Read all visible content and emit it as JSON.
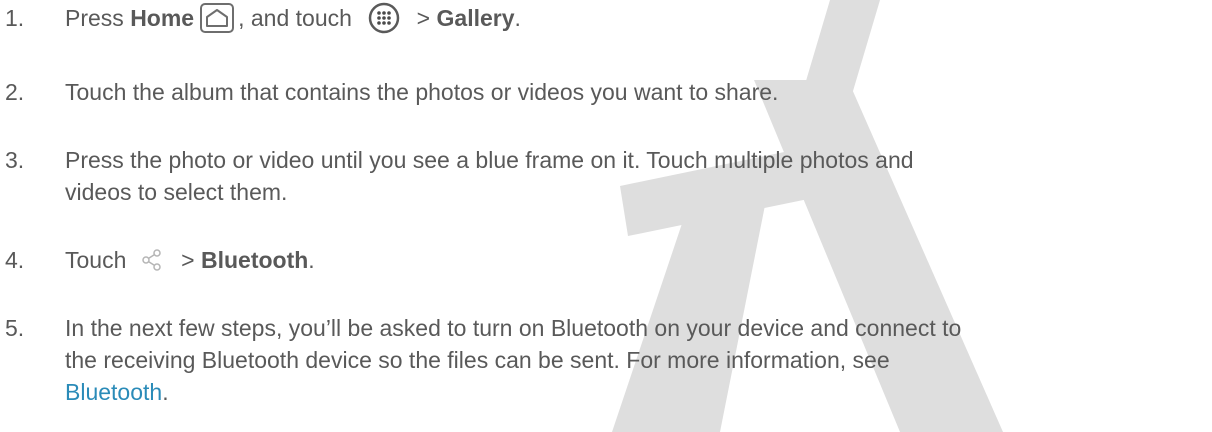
{
  "steps": [
    {
      "number": "1.",
      "press": "Press ",
      "home_label": "Home",
      "home_icon": "home-icon",
      "and_touch": ", and touch ",
      "apps_icon": "apps-icon",
      "separator": " > ",
      "gallery_label": "Gallery",
      "end": "."
    },
    {
      "number": "2.",
      "text": "Touch the album that contains the photos or videos you want to share."
    },
    {
      "number": "3.",
      "line1": "Press the photo or video until you see a blue frame on it. Touch multiple photos and",
      "line2": "videos to select them."
    },
    {
      "number": "4.",
      "touch": "Touch ",
      "share_icon": "share-icon",
      "separator": " > ",
      "bluetooth_label": "Bluetooth",
      "end": "."
    },
    {
      "number": "5.",
      "line1": "In the next few steps, you’ll be asked to turn on Bluetooth on your device and connect to",
      "line2": "the receiving Bluetooth device so the files can be sent. For more information, see",
      "link": "Bluetooth",
      "end": "."
    }
  ],
  "colors": {
    "text": "#595959",
    "link": "#2a8bb8",
    "watermark": "#d9d9d9"
  }
}
